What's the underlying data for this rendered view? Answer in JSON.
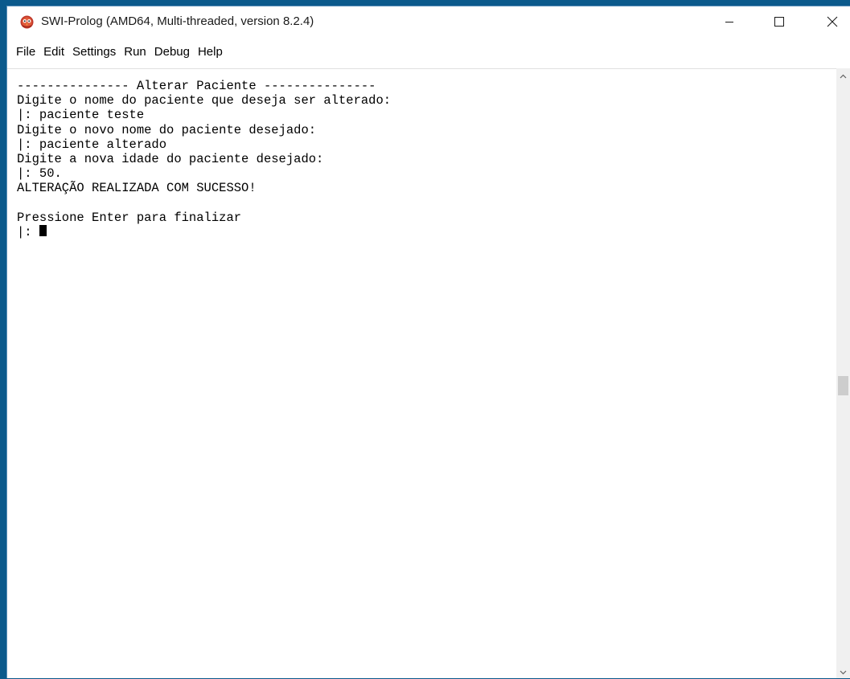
{
  "window": {
    "title": "SWI-Prolog (AMD64, Multi-threaded, version 8.2.4)",
    "app_icon": "swi-prolog-owl-icon",
    "controls": {
      "minimize_icon": "minimize-icon",
      "maximize_icon": "maximize-icon",
      "close_icon": "close-icon"
    }
  },
  "menu": {
    "items": [
      {
        "label": "File"
      },
      {
        "label": "Edit"
      },
      {
        "label": "Settings"
      },
      {
        "label": "Run"
      },
      {
        "label": "Debug"
      },
      {
        "label": "Help"
      }
    ]
  },
  "console": {
    "lines": [
      "--------------- Alterar Paciente ---------------",
      "Digite o nome do paciente que deseja ser alterado:",
      "|: paciente teste",
      "Digite o novo nome do paciente desejado:",
      "|: paciente alterado",
      "Digite a nova idade do paciente desejado:",
      "|: 50.",
      "ALTERAÇÃO REALIZADA COM SUCESSO!",
      "",
      "Pressione Enter para finalizar"
    ],
    "prompt": "|: "
  },
  "colors": {
    "desktop": "#0b5a8c",
    "window_bg": "#ffffff",
    "text": "#000000",
    "scrollbar_track": "#f0f0f0",
    "scrollbar_thumb": "#cdcdcd"
  }
}
